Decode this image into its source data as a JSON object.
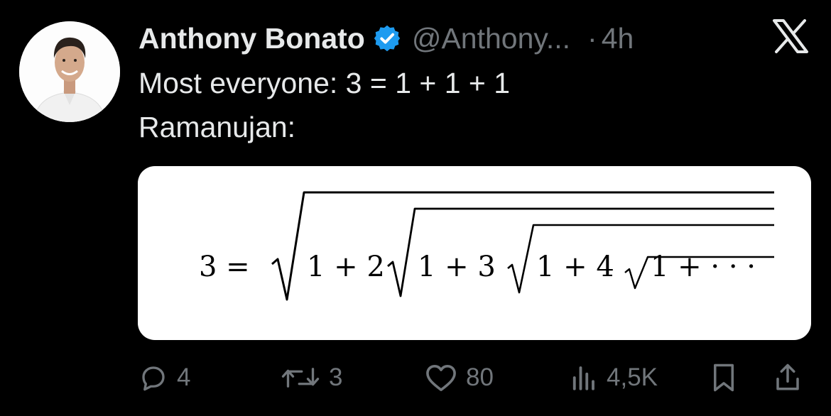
{
  "tweet": {
    "display_name": "Anthony Bonato",
    "handle": "@Anthony...",
    "separator": "·",
    "time": "4h",
    "text_line_1": "Most everyone: 3 = 1 + 1 + 1",
    "text_line_2": "Ramanujan:"
  },
  "media": {
    "formula_lhs": "3 =",
    "terms": [
      "1 + 2",
      "1 + 3",
      "1 + 4",
      "1 + · · ·"
    ]
  },
  "actions": {
    "replies": "4",
    "reposts": "3",
    "likes": "80",
    "views": "4,5K"
  },
  "icons": {
    "verified": "verified-badge-icon",
    "close": "x-logo-icon",
    "reply": "reply-icon",
    "repost": "repost-icon",
    "like": "heart-icon",
    "views": "views-chart-icon",
    "bookmark": "bookmark-icon",
    "share": "share-icon"
  },
  "colors": {
    "background": "#000000",
    "text": "#e7e9ea",
    "muted": "#71767b",
    "verified": "#1d9bf0"
  }
}
